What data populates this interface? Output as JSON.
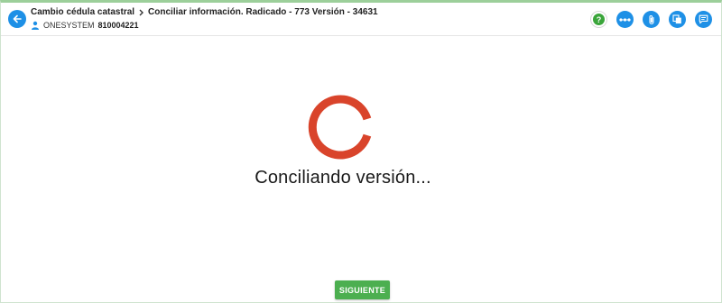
{
  "header": {
    "breadcrumb_parent": "Cambio cédula catastral",
    "breadcrumb_current": "Conciliar información. Radicado - 773 Versión - 34631",
    "user_name": "ONESYSTEM",
    "user_code": "810004221"
  },
  "icons": {
    "back": "arrow-left-icon",
    "separator": "chevron-right-icon",
    "user": "user-icon",
    "help": "question-icon",
    "link": "dots-link-icon",
    "attach": "paperclip-icon",
    "copy": "copy-icon",
    "comment": "comment-icon"
  },
  "main": {
    "loading_text": "Conciliando versión..."
  },
  "footer": {
    "next_label": "SIGUIENTE"
  },
  "colors": {
    "accent": "#1e90e6",
    "spinner": "#d9442b",
    "button": "#4caf50",
    "help": "#3aa53a"
  }
}
